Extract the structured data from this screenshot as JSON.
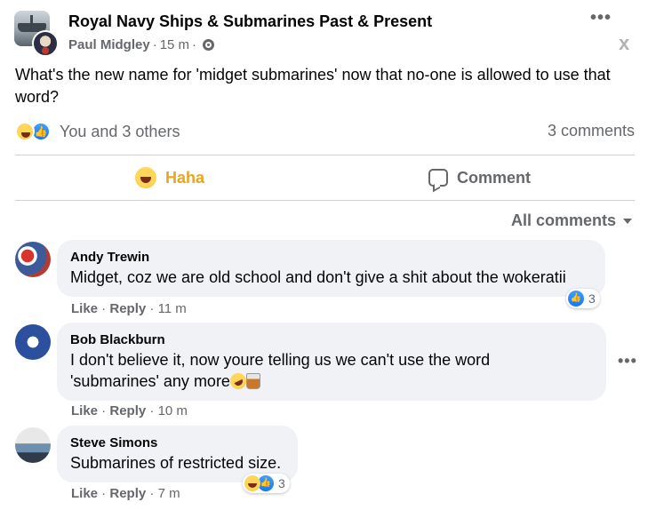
{
  "post": {
    "group_name": "Royal Navy Ships & Submarines Past & Present",
    "author": "Paul Midgley",
    "time": "15 m",
    "dot": "·",
    "text": "What's the new name for 'midget submarines' now that no-one is allowed to use that word?",
    "reactions_text": "You and 3 others",
    "comments_count": "3 comments"
  },
  "actions": {
    "haha_label": "Haha",
    "comment_label": "Comment"
  },
  "filter": {
    "label": "All comments"
  },
  "comments": [
    {
      "author": "Andy Trewin",
      "text": "Midget, coz we are old school and don't give a shit about the wokeratii",
      "like": "Like",
      "reply": "Reply",
      "time": "11 m",
      "reaction_count": "3",
      "reaction_icons": [
        "like-icon"
      ]
    },
    {
      "author": "Bob Blackburn",
      "text_line1": "I don't believe it, now youre telling us we can't use the word",
      "text_line2": "'submarines' any more",
      "like": "Like",
      "reply": "Reply",
      "time": "10 m",
      "inline_emojis": [
        "rofl-emoji",
        "whisky-emoji"
      ]
    },
    {
      "author": "Steve Simons",
      "text": "Submarines of restricted size.",
      "like": "Like",
      "reply": "Reply",
      "time": "7 m",
      "reaction_count": "3",
      "reaction_icons": [
        "haha-icon",
        "like-icon"
      ]
    }
  ],
  "colors": {
    "haha_accent": "#e8a521",
    "secondary_text": "#65676b",
    "bubble_bg": "#f0f2f5",
    "like_blue": "#1877f2"
  }
}
